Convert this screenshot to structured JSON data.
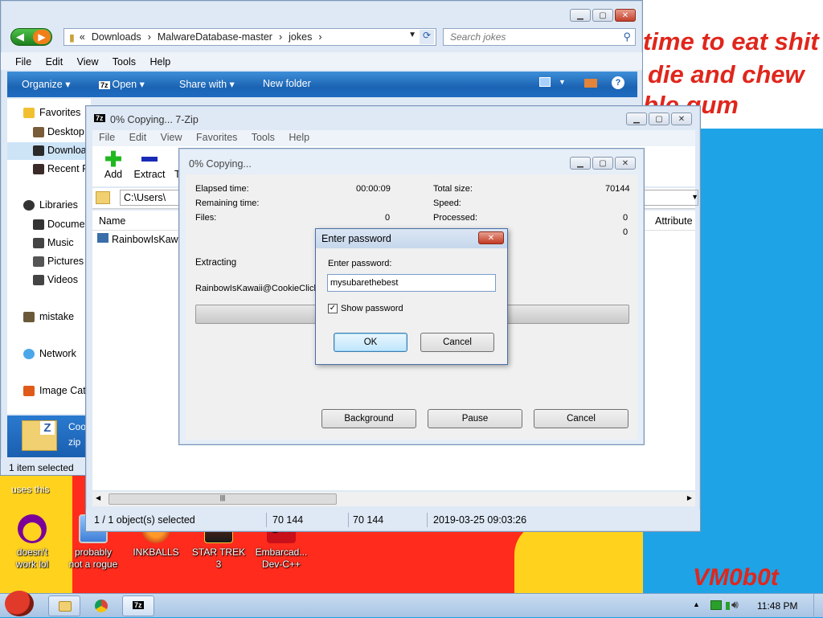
{
  "wallpaper": {
    "lines": [
      "time to eat shit",
      "die and chew",
      "ble gum"
    ],
    "signature": "VM0b0t",
    "uses_this": "uses this"
  },
  "explorer": {
    "address": [
      "Downloads",
      "MalwareDatabase-master",
      "jokes"
    ],
    "search_placeholder": "Search jokes",
    "menu": [
      "File",
      "Edit",
      "View",
      "Tools",
      "Help"
    ],
    "toolbar": [
      "Organize",
      "Open",
      "Share with",
      "New folder"
    ],
    "nav": {
      "favorites": "Favorites",
      "desktop": "Desktop",
      "downloads": "Downloads",
      "recent": "Recent P",
      "libraries": "Libraries",
      "documents": "Docume",
      "music": "Music",
      "pictures": "Pictures",
      "videos": "Videos",
      "mistake": "mistake",
      "network": "Network",
      "imagecat": "Image Cat"
    },
    "selected_file_name": "Coo",
    "selected_file_type": "zip",
    "status": "1 item selected"
  },
  "sevenzip": {
    "title": "0% Copying... 7-Zip",
    "menu": [
      "File",
      "Edit",
      "View",
      "Favorites",
      "Tools",
      "Help"
    ],
    "tools": {
      "add": "Add",
      "extract": "Extract",
      "test": "T"
    },
    "path": "C:\\Users\\",
    "col_name": "Name",
    "col_attr": "Attribute",
    "file": "RainbowIsKawai",
    "status": {
      "selected": "1 / 1 object(s) selected",
      "size1": "70 144",
      "size2": "70 144",
      "date": "2019-03-25 09:03:26"
    }
  },
  "progress": {
    "title": "0% Copying...",
    "elapsed_label": "Elapsed time:",
    "elapsed": "00:00:09",
    "remaining_label": "Remaining time:",
    "files_label": "Files:",
    "files": "0",
    "total_label": "Total size:",
    "total": "70144",
    "speed_label": "Speed:",
    "processed_label": "Processed:",
    "processed": "0",
    "extra": "0",
    "action": "Extracting",
    "current": "RainbowIsKawaii@CookieClicke",
    "progress_fraction": 0,
    "buttons": {
      "background": "Background",
      "pause": "Pause",
      "cancel": "Cancel"
    }
  },
  "password": {
    "title": "Enter password",
    "label": "Enter password:",
    "value": "mysubarethebest",
    "show_label": "Show password",
    "show_checked": true,
    "ok": "OK",
    "cancel": "Cancel"
  },
  "desktop_icons": [
    {
      "label1": "doesn't",
      "label2": "work lol"
    },
    {
      "label1": "probably",
      "label2": "not a rogue"
    },
    {
      "label1": "INKBALLS",
      "label2": ""
    },
    {
      "label1": "STAR TREK",
      "label2": "3"
    },
    {
      "label1": "Embarcad...",
      "label2": "Dev-C++"
    }
  ],
  "taskbar": {
    "time": "11:48 PM"
  }
}
